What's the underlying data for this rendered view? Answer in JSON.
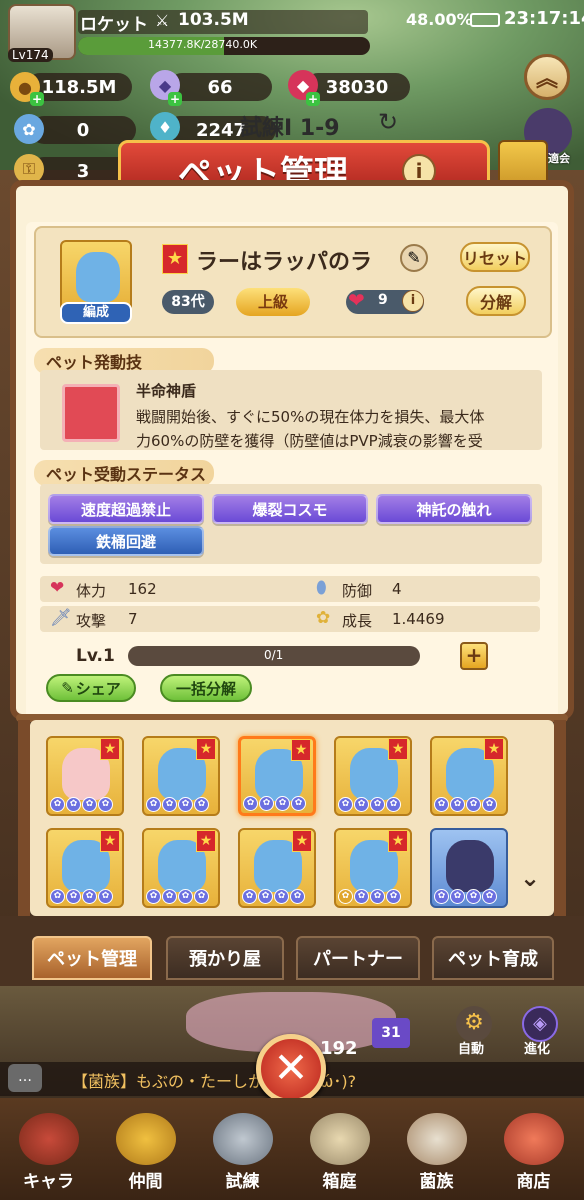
{
  "status_bar": {
    "battery": "48.00%",
    "time": "23:17:14"
  },
  "player": {
    "name": "ロケット",
    "level": "Lv174",
    "power": "103.5M",
    "exp": "14377.8K/28740.0K"
  },
  "resources": {
    "gold": "118.5M",
    "crystal": "66",
    "gem": "38030",
    "orb": "0",
    "potion": "2247",
    "key": "3"
  },
  "stage": {
    "label": "試練Ⅰ 1-9"
  },
  "banner": {
    "title": "ペット管理",
    "side_label": "適会"
  },
  "pet": {
    "name": "ラーはラッパのラ",
    "team_label": "編成",
    "generation": "83代",
    "rank": "上級",
    "hearts": "9",
    "reset_label": "リセット",
    "dismantle_label": "分解"
  },
  "active_skill": {
    "section_title": "ペット発動技",
    "name": "半命神盾",
    "desc_line1": "戦闘開始後、すぐに50%の現在体力を損失、最大体",
    "desc_line2": "力60%の防壁を獲得（防壁値はPVP減衰の影響を受"
  },
  "passive": {
    "section_title": "ペット受動ステータス",
    "tags": [
      "速度超過禁止",
      "爆裂コスモ",
      "神託の触れ",
      "鉄桶回避"
    ]
  },
  "stats": {
    "hp_label": "体力",
    "hp": "162",
    "def_label": "防御",
    "def": "4",
    "atk_label": "攻撃",
    "atk": "7",
    "growth_label": "成長",
    "growth": "1.4469"
  },
  "level": {
    "label": "Lv.1",
    "progress_text": "0/1",
    "progress": 0
  },
  "actions": {
    "share": "シェア",
    "bulk_dismantle": "一括分解"
  },
  "tabs": [
    "ペット管理",
    "預かり屋",
    "パートナー",
    "ペット育成"
  ],
  "bottom_bar": {
    "number": "192",
    "badge": "31",
    "auto": "自動",
    "evolve": "進化"
  },
  "chat": {
    "text": "【菌族】もぶの・たーしかるかな･ώ･)?"
  },
  "nav": [
    "キャラ",
    "仲間",
    "試練",
    "箱庭",
    "菌族",
    "商店"
  ],
  "colors": {
    "accent": "#d6282b",
    "panel": "#fbf1d8",
    "frame": "#7a4b2a"
  }
}
